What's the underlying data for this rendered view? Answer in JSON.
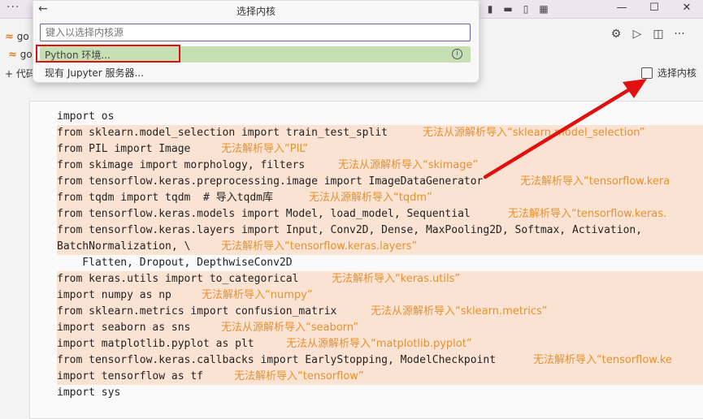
{
  "titlebar": {
    "menu_dots": "···"
  },
  "window_controls": {
    "minimize": "—",
    "maximize": "☐",
    "close": "✕"
  },
  "tabs": [
    {
      "label": "go"
    },
    {
      "label": "go"
    }
  ],
  "toolbar": {
    "add_code_label": "+ 代码"
  },
  "kernel_button": {
    "label": "选择内核"
  },
  "palette": {
    "title": "选择内核",
    "placeholder": "键入以选择内核源",
    "options": [
      {
        "label": "Python 环境..."
      },
      {
        "label": "现有 Jupyter 服务器..."
      }
    ]
  },
  "code_lines": [
    "import os",
    "from sklearn.model_selection import train_test_split",
    "from PIL import Image",
    "from skimage import morphology, filters",
    "from tensorflow.keras.preprocessing.image import ImageDataGenerator",
    "from tqdm import tqdm  # 导入tqdm库",
    "from tensorflow.keras.models import Model, load_model, Sequential",
    "from tensorflow.keras.layers import Input, Conv2D, Dense, MaxPooling2D, Softmax, Activation,",
    "BatchNormalization, \\",
    "    Flatten, Dropout, DepthwiseConv2D",
    "from keras.utils import to_categorical",
    "import numpy as np",
    "from sklearn.metrics import confusion_matrix",
    "import seaborn as sns",
    "import matplotlib.pyplot as plt",
    "from tensorflow.keras.callbacks import EarlyStopping, ModelCheckpoint",
    "import tensorflow as tf",
    "import sys"
  ],
  "diagnostics": [
    "无法从源解析导入“sklearn.model_selection”",
    "无法解析导入“PIL”",
    "无法从源解析导入“skimage”",
    "无法解析导入“tensorflow.kera",
    "无法从源解析导入“tqdm”",
    "无法解析导入“tensorflow.keras.",
    "无法解析导入“tensorflow.keras.layers”",
    "无法解析导入“keras.utils”",
    "无法解析导入“numpy”",
    "无法从源解析导入“sklearn.metrics”",
    "无法从源解析导入“seaborn”",
    "无法从源解析导入“matplotlib.pyplot”",
    "无法解析导入“tensorflow.ke",
    "无法解析导入“tensorflow”"
  ],
  "colors": {
    "highlight": "#c6e0b4",
    "annotation": "#e01010",
    "warning": "#e69030",
    "keyword": "#3c4ba6"
  }
}
